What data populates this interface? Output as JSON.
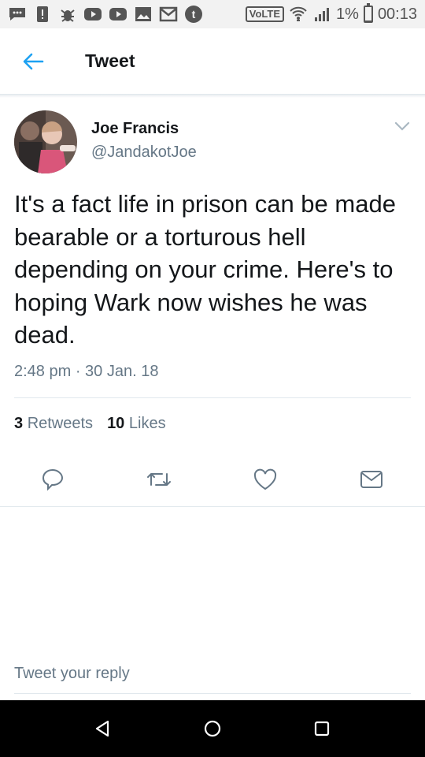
{
  "status_bar": {
    "battery_percent": "1%",
    "battery_level": 0.01,
    "time": "00:13",
    "network_label": "VoLTE",
    "icons": [
      "chat-icon",
      "alert-icon",
      "bug-icon",
      "youtube-icon",
      "youtube-icon",
      "image-icon",
      "gmail-icon",
      "tumblr-icon"
    ]
  },
  "header": {
    "title": "Tweet"
  },
  "tweet": {
    "author_name": "Joe Francis",
    "author_handle": "@JandakotJoe",
    "text": "It's a fact life in prison can be made bearable or a torturous hell depending on your crime. Here's to hoping Wark now wishes he was dead.",
    "timestamp": "2:48 pm · 30 Jan. 18",
    "retweets_count": "3",
    "retweets_label": "Retweets",
    "likes_count": "10",
    "likes_label": "Likes"
  },
  "reply": {
    "placeholder": "Tweet your reply"
  },
  "colors": {
    "accent": "#1da1f2",
    "secondary_text": "#657786",
    "divider": "#e1e8ed"
  }
}
